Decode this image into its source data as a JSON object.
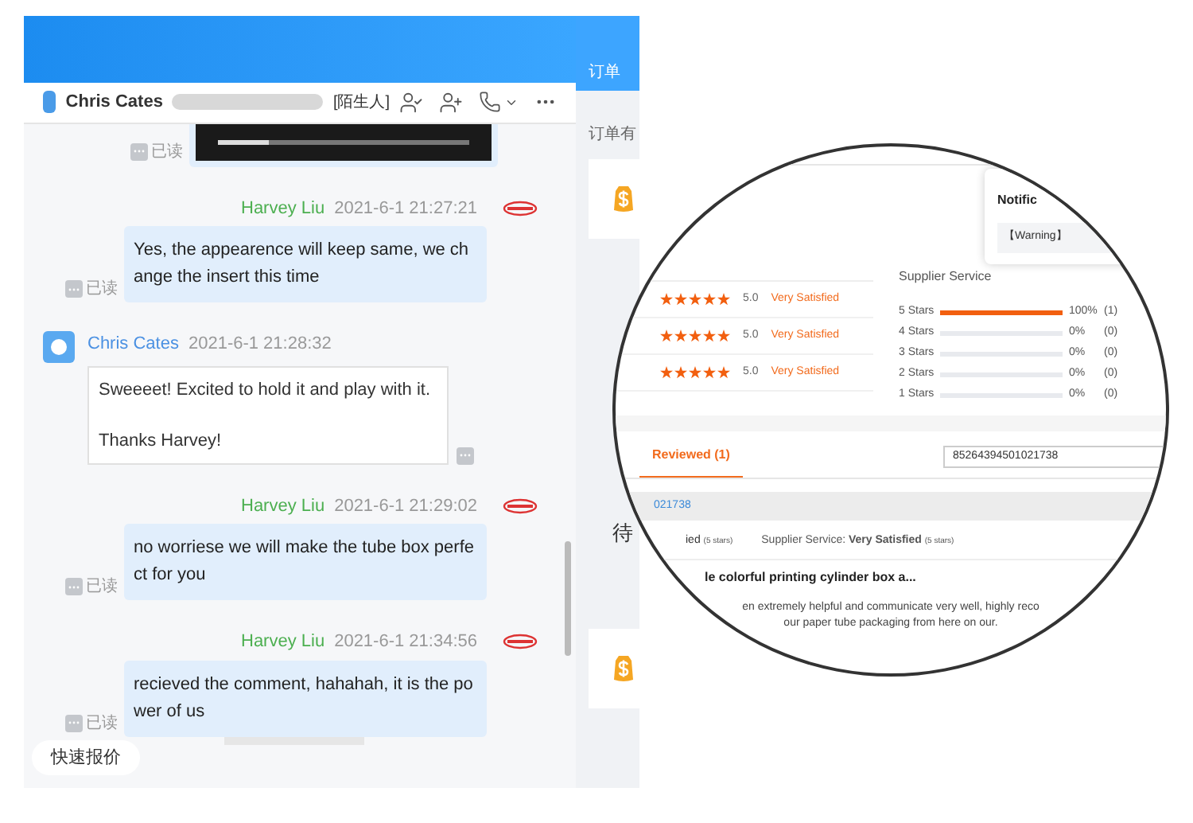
{
  "chat": {
    "header": {
      "name": "Chris Cates",
      "tag": "[陌生人]"
    },
    "messages": [
      {
        "kind": "video",
        "read_label": "已读",
        "level": 0.2
      },
      {
        "kind": "outgoing",
        "sender": "Harvey Liu",
        "time": "2021-6-1 21:27:21",
        "text": "Yes, the appearence will keep same, we change the insert this time",
        "read_label": "已读"
      },
      {
        "kind": "incoming",
        "sender": "Chris Cates",
        "time": "2021-6-1 21:28:32",
        "text": "Sweeeet! Excited to hold it and play with it.\n\nThanks Harvey!"
      },
      {
        "kind": "outgoing",
        "sender": "Harvey Liu",
        "time": "2021-6-1 21:29:02",
        "text": "no worriese we will make the tube box perfect for you",
        "read_label": "已读"
      },
      {
        "kind": "outgoing",
        "sender": "Harvey Liu",
        "time": "2021-6-1 21:34:56",
        "text": "recieved the comment, hahahah, it is the power of us",
        "read_label": "已读"
      }
    ],
    "quick_reply": "快速报价"
  },
  "side_panel": {
    "tab": "订单",
    "heading": "订单有",
    "status": "待"
  },
  "magnifier": {
    "notification": {
      "title": "Notific",
      "warning": "【Warning】"
    },
    "ratings": [
      {
        "stars": 5,
        "score": "5.0",
        "label": "Very Satisfied"
      },
      {
        "stars": 5,
        "score": "5.0",
        "label": "Very Satisfied"
      },
      {
        "stars": 5,
        "score": "5.0",
        "label": "Very Satisfied"
      }
    ],
    "supplier_service": {
      "title": "Supplier Service",
      "rows": [
        {
          "label": "5 Stars",
          "level": 1,
          "percent": "100%",
          "count": "(1)"
        },
        {
          "label": "4 Stars",
          "level": 0,
          "percent": "0%",
          "count": "(0)"
        },
        {
          "label": "3 Stars",
          "level": 0,
          "percent": "0%",
          "count": "(0)"
        },
        {
          "label": "2 Stars",
          "level": 0,
          "percent": "0%",
          "count": "(0)"
        },
        {
          "label": "1 Stars",
          "level": 0,
          "percent": "0%",
          "count": "(0)"
        }
      ]
    },
    "tabs": [
      {
        "label": "Reviewed (1)",
        "selected": true
      }
    ],
    "search": {
      "value": "85264394501021738"
    },
    "order_number": "021738",
    "review": {
      "rating_text": "ied",
      "rating_note": "(5 stars)",
      "supplier": "Supplier Service: **Very Satisfied**",
      "supplier_note": "(5 stars)",
      "title": "le colorful printing cylinder box a...",
      "body": [
        "en extremely helpful and communicate very well, highly reco",
        "our paper tube packaging from here on our."
      ]
    }
  }
}
